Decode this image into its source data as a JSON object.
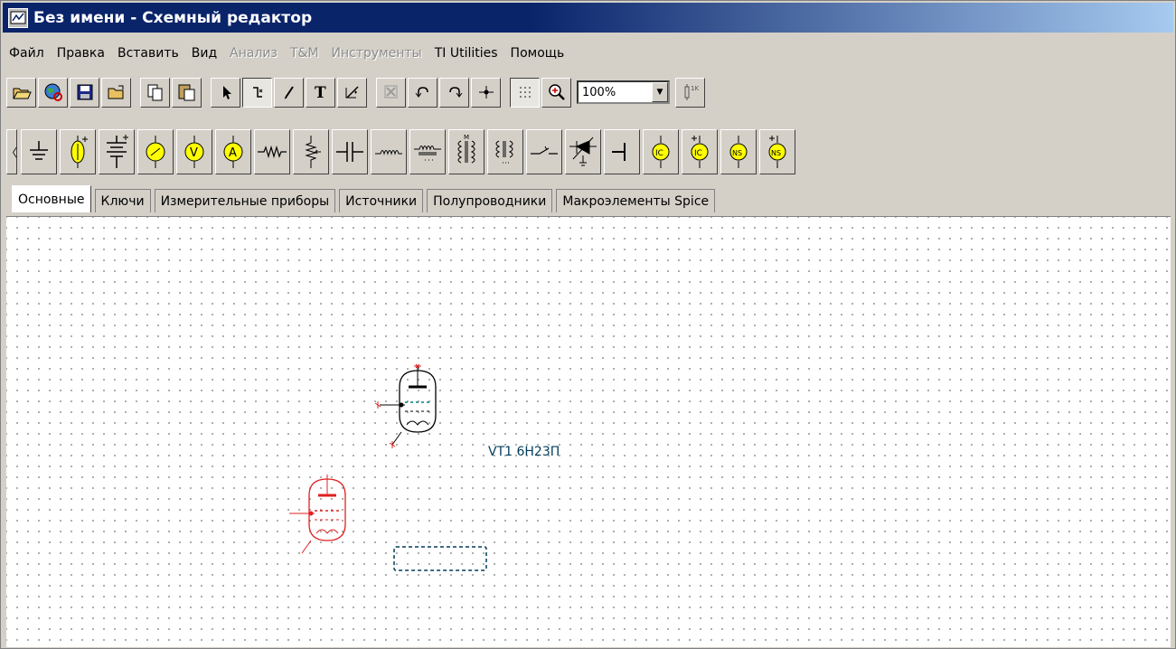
{
  "window": {
    "title": "Без имени - Схемный редактор"
  },
  "menu": [
    {
      "label": "Файл",
      "enabled": true
    },
    {
      "label": "Правка",
      "enabled": true
    },
    {
      "label": "Вставить",
      "enabled": true
    },
    {
      "label": "Вид",
      "enabled": true
    },
    {
      "label": "Анализ",
      "enabled": false
    },
    {
      "label": "T&M",
      "enabled": false
    },
    {
      "label": "Инструменты",
      "enabled": false
    },
    {
      "label": "TI Utilities",
      "enabled": true
    },
    {
      "label": "Помощь",
      "enabled": true
    }
  ],
  "toolbar": {
    "zoom_value": "100%"
  },
  "tabs": {
    "items": [
      "Основные",
      "Ключи",
      "Измерительные приборы",
      "Источники",
      "Полупроводники",
      "Макроэлементы Spice"
    ],
    "active": "Основные"
  },
  "canvas": {
    "label_designator": "VT1",
    "label_part": "6Н23П"
  },
  "colors": {
    "accent_title": "#0a246a",
    "selected": "#e02020",
    "component": "#000000",
    "label": "#003c5a",
    "meter_fill": "#ffff00"
  },
  "icons": {
    "toolbar": [
      "open-folder-icon",
      "globe-icon",
      "save-icon",
      "open-icon",
      "copy-icon",
      "paste-icon",
      "pointer-icon",
      "wire-icon",
      "pencil-icon",
      "text-icon",
      "probe-icon",
      "delete-icon",
      "undo-icon",
      "redo-icon",
      "junction-icon",
      "grid-icon",
      "zoom-icon",
      "resistor-label-icon"
    ],
    "components": [
      "ground-icon",
      "voltage-source-icon",
      "battery-icon",
      "voltmeter-icon",
      "voltmeter-v-icon",
      "ammeter-icon",
      "resistor-icon",
      "potentiometer-icon",
      "capacitor-icon",
      "inductor-icon",
      "inductor-core-icon",
      "transformer-icon",
      "transformer-core-icon",
      "switch-icon",
      "varicap-icon",
      "terminal-icon",
      "current-source-icon",
      "dc-current-source-icon",
      "noise-source-icon",
      "dc-noise-source-icon"
    ]
  }
}
